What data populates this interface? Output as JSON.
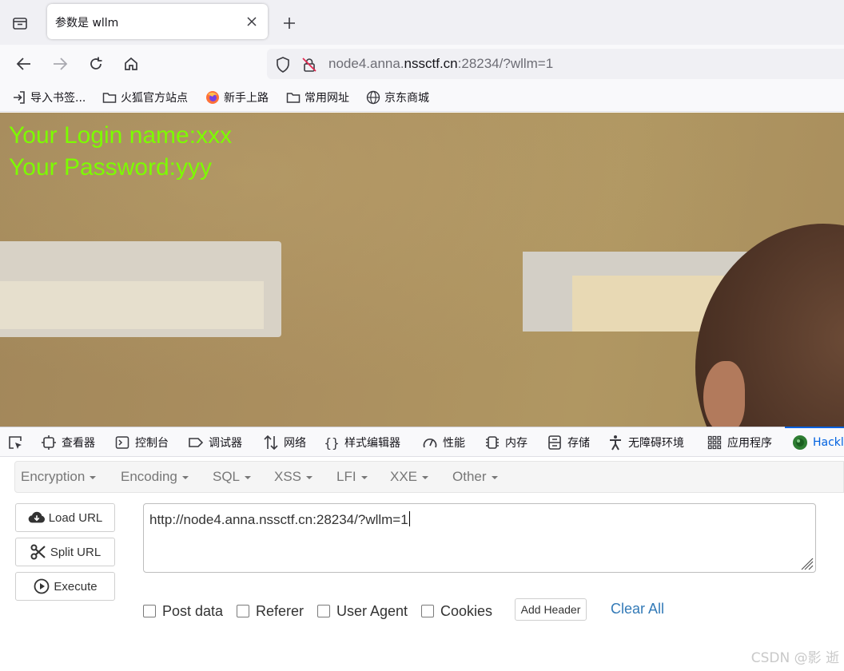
{
  "browser": {
    "tab": {
      "title": "参数是 wllm"
    },
    "address": {
      "prefix": "node4.anna.",
      "host": "nssctf.cn",
      "suffix": ":28234/?wllm=1"
    },
    "bookmarks": [
      {
        "label": "导入书签...",
        "icon": "import-icon"
      },
      {
        "label": "火狐官方站点",
        "icon": "folder-icon"
      },
      {
        "label": "新手上路",
        "icon": "firefox-icon"
      },
      {
        "label": "常用网址",
        "icon": "folder-icon"
      },
      {
        "label": "京东商城",
        "icon": "globe-icon"
      }
    ]
  },
  "page": {
    "login_line": "Your Login name:xxx",
    "password_line": "Your Password:yyy",
    "text_color": "#7cfc00"
  },
  "devtools": {
    "tabs": [
      {
        "label": "查看器",
        "icon": "inspector-icon"
      },
      {
        "label": "控制台",
        "icon": "console-icon"
      },
      {
        "label": "调试器",
        "icon": "debugger-icon"
      },
      {
        "label": "网络",
        "icon": "network-icon"
      },
      {
        "label": "样式编辑器",
        "icon": "style-editor-icon"
      },
      {
        "label": "性能",
        "icon": "performance-icon"
      },
      {
        "label": "内存",
        "icon": "memory-icon"
      },
      {
        "label": "存储",
        "icon": "storage-icon"
      },
      {
        "label": "无障碍环境",
        "icon": "accessibility-icon"
      },
      {
        "label": "应用程序",
        "icon": "application-icon"
      },
      {
        "label": "Hackl",
        "icon": "hackbar-icon"
      }
    ]
  },
  "hackbar": {
    "menu": [
      "Encryption",
      "Encoding",
      "SQL",
      "XSS",
      "LFI",
      "XXE",
      "Other"
    ],
    "buttons": {
      "load": "Load URL",
      "split": "Split URL",
      "execute": "Execute"
    },
    "url_value": "http://node4.anna.nssctf.cn:28234/?wllm=1",
    "checkboxes": [
      "Post data",
      "Referer",
      "User Agent",
      "Cookies"
    ],
    "add_header": "Add Header",
    "clear_all": "Clear All"
  },
  "watermark": "CSDN @影 逝"
}
